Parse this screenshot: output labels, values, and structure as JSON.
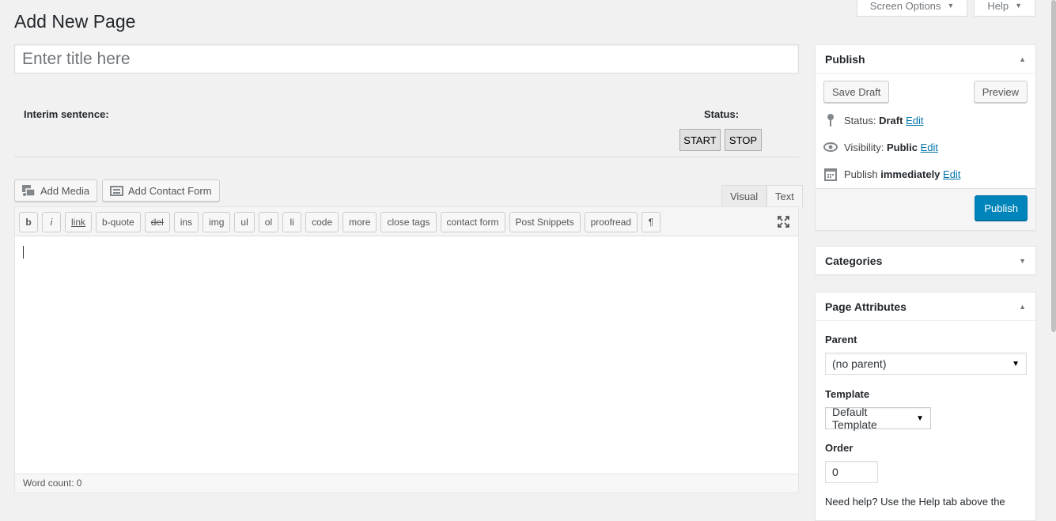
{
  "screen_meta": {
    "screen_options": "Screen Options",
    "help": "Help"
  },
  "page_title": "Add New Page",
  "title_input": {
    "placeholder": "Enter title here",
    "value": ""
  },
  "dictation": {
    "interim_label": "Interim sentence:",
    "status_label": "Status:",
    "start": "START",
    "stop": "STOP"
  },
  "media_buttons": {
    "add_media": "Add Media",
    "add_contact_form": "Add Contact Form"
  },
  "editor_tabs": {
    "visual": "Visual",
    "text": "Text",
    "active": "Text"
  },
  "quicktags": [
    "b",
    "i",
    "link",
    "b-quote",
    "del",
    "ins",
    "img",
    "ul",
    "ol",
    "li",
    "code",
    "more",
    "close tags",
    "contact form",
    "Post Snippets",
    "proofread",
    "¶"
  ],
  "word_count": "Word count: 0",
  "publish": {
    "heading": "Publish",
    "save_draft": "Save Draft",
    "preview": "Preview",
    "status_label": "Status:",
    "status_value": "Draft",
    "visibility_label": "Visibility:",
    "visibility_value": "Public",
    "publish_label": "Publish",
    "publish_value": "immediately",
    "edit": "Edit",
    "publish_button": "Publish"
  },
  "categories": {
    "heading": "Categories"
  },
  "page_attributes": {
    "heading": "Page Attributes",
    "parent_label": "Parent",
    "parent_value": "(no parent)",
    "template_label": "Template",
    "template_value": "Default Template",
    "order_label": "Order",
    "order_value": "0",
    "help_text": "Need help? Use the Help tab above the"
  },
  "colors": {
    "primary": "#0085ba",
    "link": "#0073aa",
    "background": "#f1f1f1"
  }
}
